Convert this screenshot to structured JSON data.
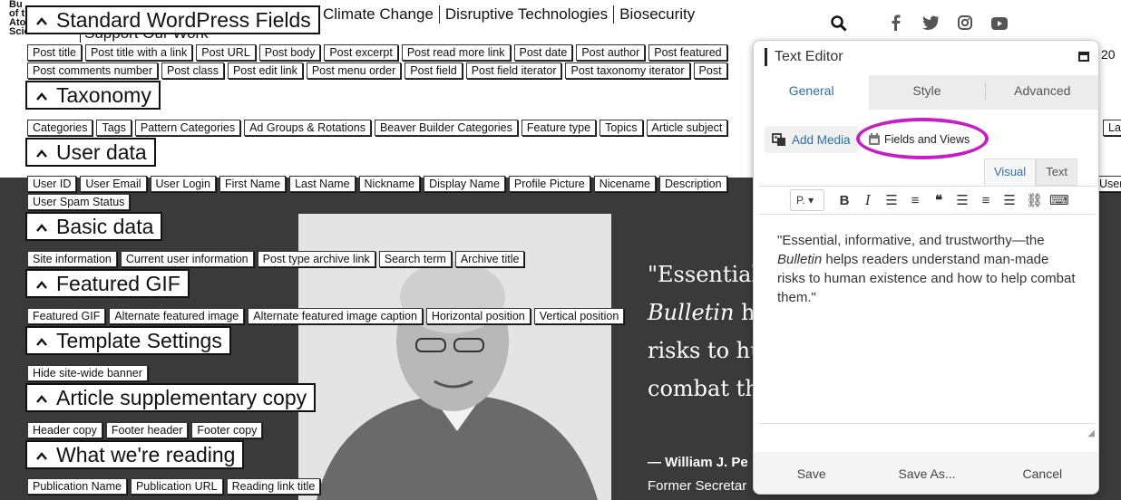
{
  "site": {
    "logo_lines": [
      "Bu",
      "of t",
      "Ato",
      "Scientists"
    ],
    "nav": [
      "Climate Change",
      "Disruptive Technologies",
      "Biosecurity"
    ],
    "support": "Support Our Work",
    "social_icons": [
      "search-icon",
      "facebook-icon",
      "twitter-icon",
      "instagram-icon",
      "youtube-icon"
    ],
    "right_clip": "20"
  },
  "quote": {
    "line1": "\"Essential",
    "line2_em": "Bulletin",
    "line2_rest": " h",
    "line3": "risks to hu",
    "line4": "combat th",
    "author": "— William J. Pe",
    "role": "Former Secretar"
  },
  "fields_panel": {
    "sections": [
      {
        "title": "Standard WordPress Fields",
        "rows": [
          [
            "Post title",
            "Post title with a link",
            "Post URL",
            "Post body",
            "Post excerpt",
            "Post read more link",
            "Post date",
            "Post author",
            "Post featured"
          ],
          [
            "Post comments number",
            "Post class",
            "Post edit link",
            "Post menu order",
            "Post field",
            "Post field iterator",
            "Post taxonomy iterator",
            "Post"
          ]
        ]
      },
      {
        "title": "Taxonomy",
        "rows": [
          [
            "Categories",
            "Tags",
            "Pattern Categories",
            "Ad Groups & Rotations",
            "Beaver Builder Categories",
            "Feature type",
            "Topics",
            "Article subject"
          ]
        ]
      },
      {
        "title": "User data",
        "rows": [
          [
            "User ID",
            "User Email",
            "User Login",
            "First Name",
            "Last Name",
            "Nickname",
            "Display Name",
            "Profile Picture",
            "Nicename",
            "Description"
          ],
          [
            "User Spam Status"
          ]
        ]
      },
      {
        "title": "Basic data",
        "rows": [
          [
            "Site information",
            "Current user information",
            "Post type archive link",
            "Search term",
            "Archive title"
          ]
        ]
      },
      {
        "title": "Featured GIF",
        "rows": [
          [
            "Featured GIF",
            "Alternate featured image",
            "Alternate featured image caption",
            "Horizontal position",
            "Vertical position"
          ]
        ]
      },
      {
        "title": "Template Settings",
        "rows": [
          [
            "Hide site-wide banner"
          ]
        ]
      },
      {
        "title": "Article supplementary copy",
        "rows": [
          [
            "Header copy",
            "Footer header",
            "Footer copy"
          ]
        ]
      },
      {
        "title": "What we're reading",
        "rows": [
          [
            "Publication Name",
            "Publication URL",
            "Reading link title"
          ]
        ]
      }
    ],
    "right_chips": [
      "La",
      "User"
    ]
  },
  "editor": {
    "title": "Text Editor",
    "tabs": [
      "General",
      "Style",
      "Advanced"
    ],
    "add_media": "Add Media",
    "fields_and_views": "Fields and Views",
    "mode_tabs": [
      "Visual",
      "Text"
    ],
    "format_select": "P.",
    "content_before_em": "\"Essential, informative, and trustworthy—the ",
    "content_em": "Bulletin",
    "content_after_em": " helps readers understand man-made risks to human existence and how to help combat them.\"",
    "footer": [
      "Save",
      "Save As...",
      "Cancel"
    ],
    "highlight_color": "#c41fc4"
  }
}
